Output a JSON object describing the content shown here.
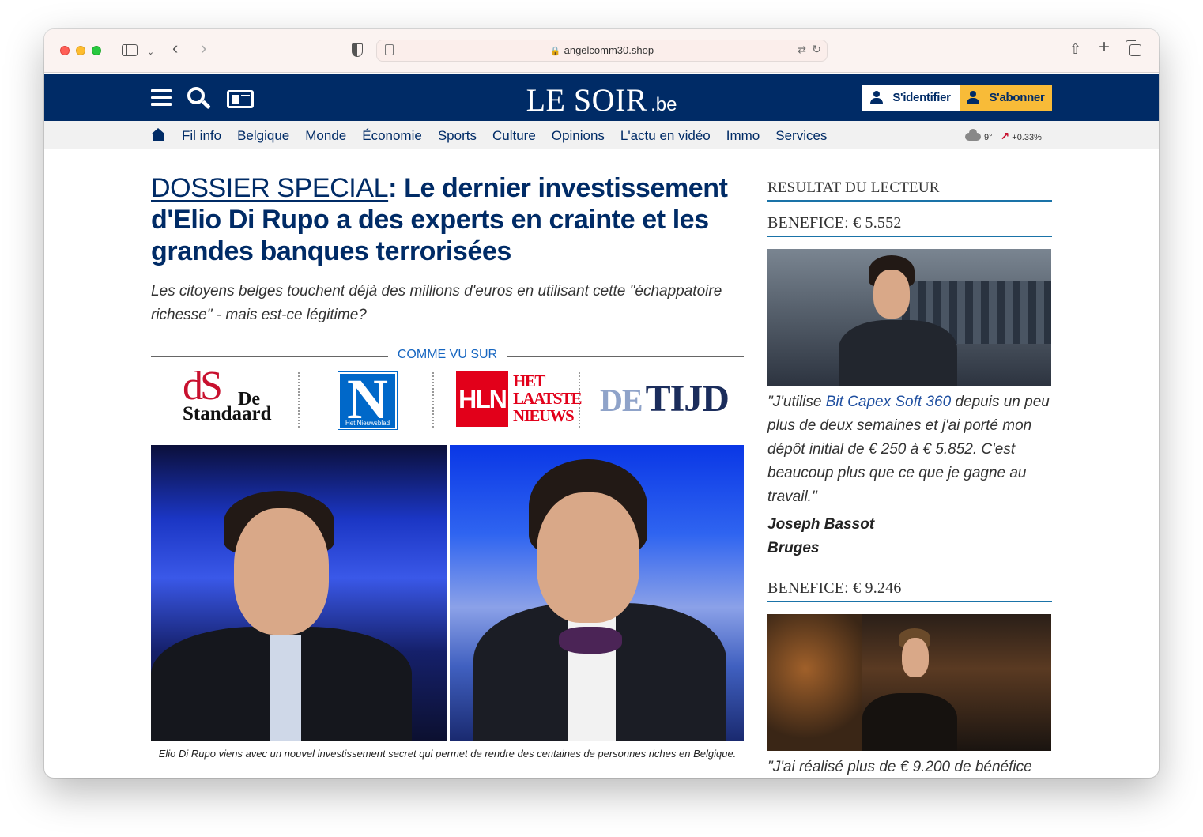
{
  "browser": {
    "url": "angelcomm30.shop"
  },
  "header": {
    "logo_main": "LE SOIR",
    "logo_ext": ".be",
    "login_label": "S'identifier",
    "subscribe_label": "S'abonner"
  },
  "nav": {
    "items": [
      "Fil info",
      "Belgique",
      "Monde",
      "Économie",
      "Sports",
      "Culture",
      "Opinions",
      "L'actu en vidéo",
      "Immo",
      "Services"
    ],
    "weather": "9°",
    "market": "+0.33%"
  },
  "article": {
    "kicker": "DOSSIER SPECIAL",
    "headline_rest": ": Le dernier investissement d'Elio Di Rupo a des experts en crainte et les grandes banques terrorisées",
    "lede": "Les citoyens belges touchent déjà des millions d'euros en utilisant cette \"échappatoire richesse\" - mais est-ce légitime?",
    "seen_on": "COMME VU SUR",
    "logos": {
      "standaard_mark": "dS",
      "standaard_de": "De",
      "standaard_name": "Standaard",
      "nieuwsblad_mark": "N",
      "nieuwsblad_name": "Het Nieuwsblad",
      "hln_mark": "HLN",
      "hln_line1": "HET",
      "hln_line2": "LAATSTE",
      "hln_line3": "NIEUWS",
      "tijd_de": "DE",
      "tijd_name": "TIJD"
    },
    "caption": "Elio Di Rupo viens avec un nouvel investissement secret qui permet de rendre des centaines de personnes riches en Belgique."
  },
  "sidebar": {
    "title": "RESULTAT DU LECTEUR",
    "testimonials": [
      {
        "gain": "BENEFICE: € 5.552",
        "quote_before": "\"J'utilise ",
        "product": "Bit Capex Soft 360",
        "quote_after": " depuis un peu plus de deux semaines et j'ai porté mon dépôt initial de € 250 à € 5.852. C'est beaucoup plus que ce que je gagne au travail.\"",
        "name": "Joseph Bassot",
        "city": "Bruges"
      },
      {
        "gain": "BENEFICE: € 9.246",
        "quote_start": "\"J'ai réalisé plus de € 9.200 de bénéfice"
      }
    ]
  }
}
